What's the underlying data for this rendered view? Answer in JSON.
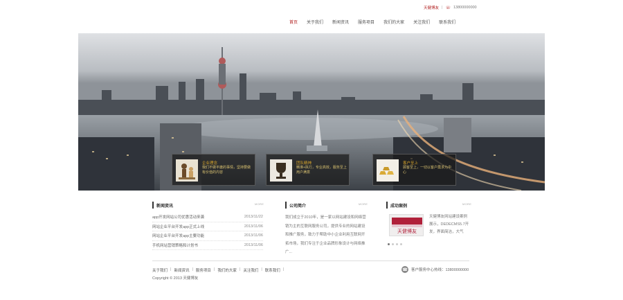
{
  "topbar": {
    "brand": "天健博友",
    "separator": "|",
    "phone": "13800000000"
  },
  "nav": [
    {
      "label": "首页",
      "active": true
    },
    {
      "label": "关于我们",
      "active": false
    },
    {
      "label": "新闻资讯",
      "active": false
    },
    {
      "label": "服务项目",
      "active": false
    },
    {
      "label": "我们的大家",
      "active": false
    },
    {
      "label": "关注我们",
      "active": false
    },
    {
      "label": "联系我们",
      "active": false
    }
  ],
  "banner": {
    "features": [
      {
        "title": "企业理念",
        "desc": "我们不做平庸的事情，坚持要做有价值的内容"
      },
      {
        "title": "团队精神",
        "desc": "精准+执行，专业高效，服务至上用户满意"
      },
      {
        "title": "客户至上",
        "desc": "顾客至上，一切以客户需求为中心"
      }
    ]
  },
  "news": {
    "title": "新闻资讯",
    "more": "MORE",
    "items": [
      {
        "text": "app开发网站公司优惠活动来袭",
        "date": "2013/11/22"
      },
      {
        "text": "网站企业平台开发app正式上线",
        "date": "2013/11/06"
      },
      {
        "text": "网站企业平台开发app主要功能",
        "date": "2013/11/06"
      },
      {
        "text": "手机网站营销策略和计划书",
        "date": "2013/11/06"
      }
    ]
  },
  "about": {
    "title": "公司简介",
    "more": "MORE",
    "text": "我们成立于2010年，是一家以网站建设和网络营销为主的互联网服务公司，提供专业的网站建设和推广服务，致力于帮助中小企业利用互联网开拓市场，我们专注于企业品牌形象设计与网络推广..."
  },
  "cases": {
    "title": "成功案例",
    "more": "MORE",
    "text": "天健博友网站建设案例展示，DEDECMS5.7开发，界面简洁，大气",
    "logo_text": "天健博友"
  },
  "footer": {
    "links": [
      "关于我们",
      "新闻资讯",
      "服务项目",
      "我们的大家",
      "关注我们",
      "联系我们"
    ],
    "copyright": "Copyright © 2013 天健博友",
    "hotline_label": "客户服务中心热线：13800000000"
  }
}
